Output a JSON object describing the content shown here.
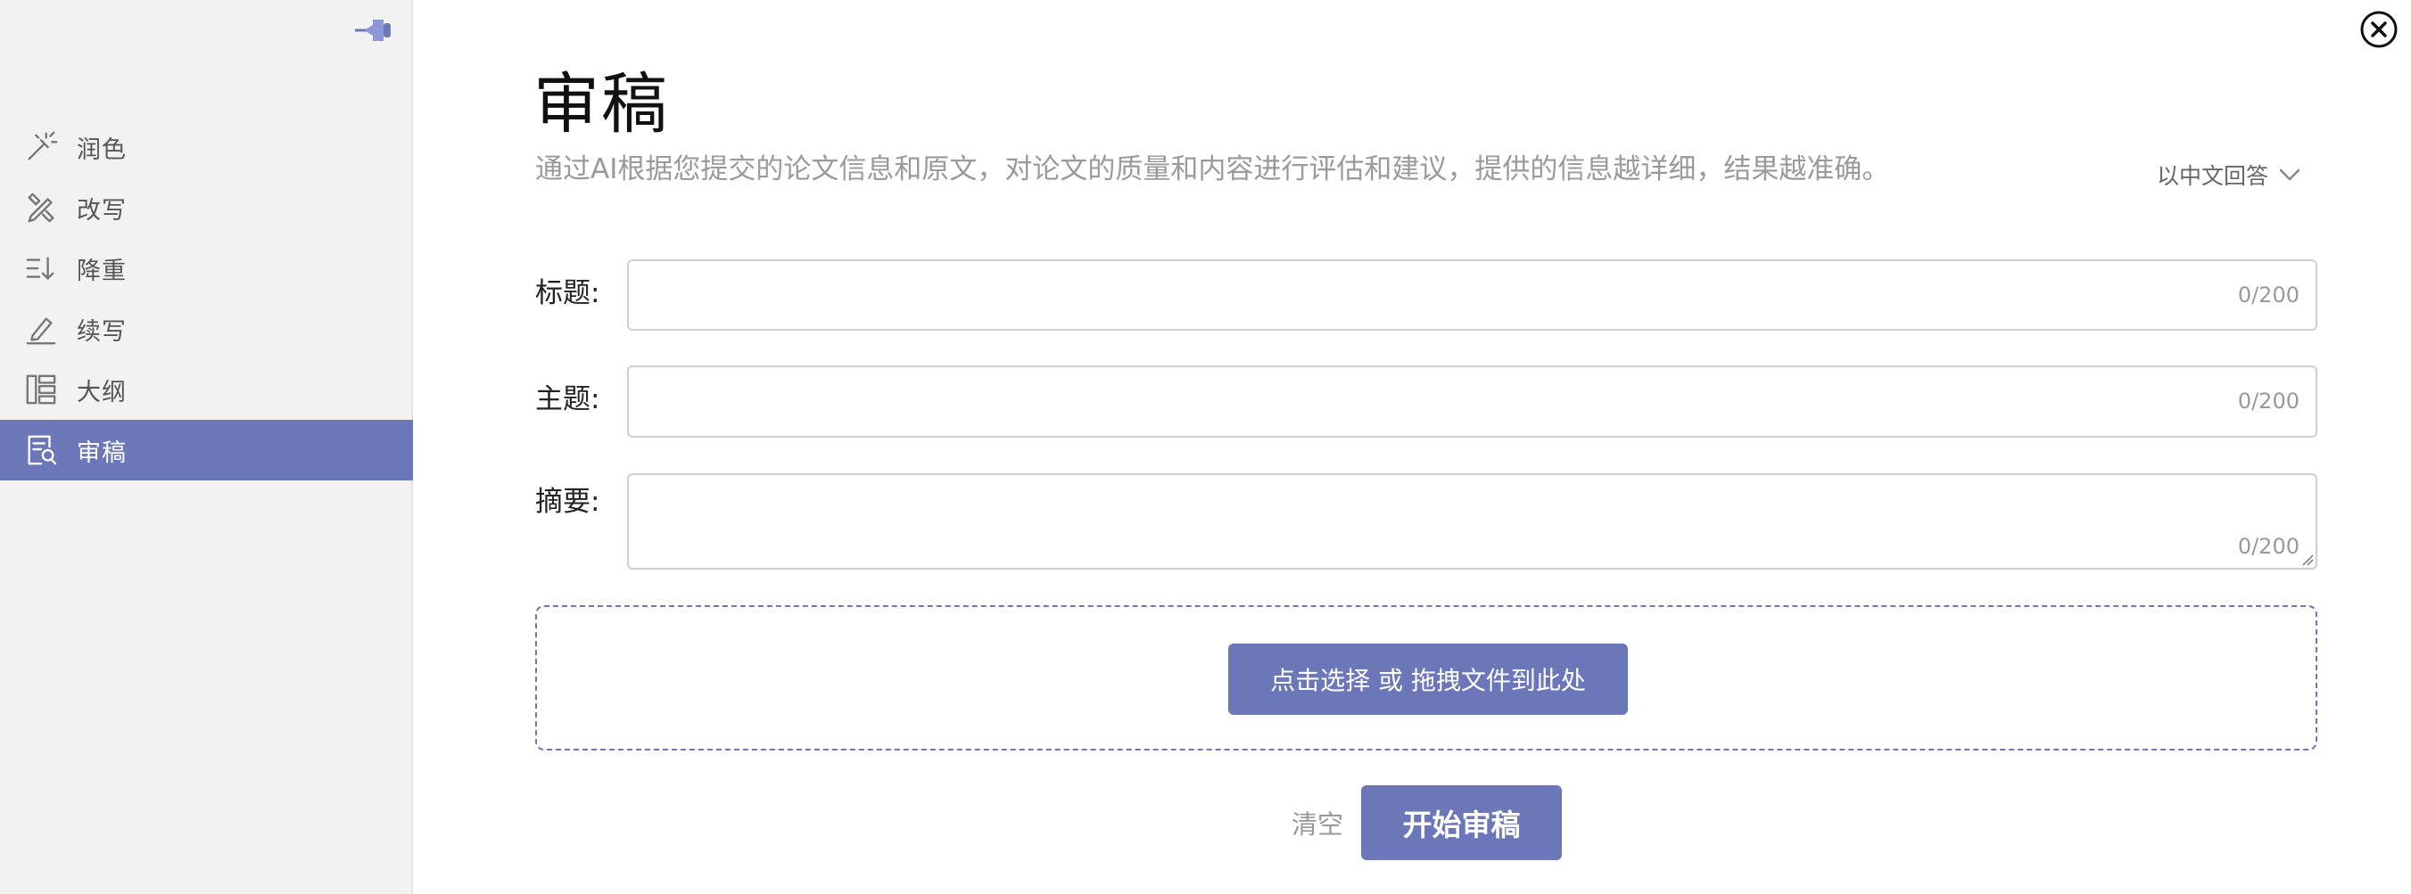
{
  "sidebar": {
    "pin_icon": "pin-icon",
    "items": [
      {
        "label": "润色",
        "icon": "magic-wand-icon",
        "active": false
      },
      {
        "label": "改写",
        "icon": "rewrite-icon",
        "active": false
      },
      {
        "label": "降重",
        "icon": "sort-down-icon",
        "active": false
      },
      {
        "label": "续写",
        "icon": "pen-icon",
        "active": false
      },
      {
        "label": "大纲",
        "icon": "outline-icon",
        "active": false
      },
      {
        "label": "审稿",
        "icon": "review-icon",
        "active": true
      }
    ]
  },
  "main": {
    "title": "审稿",
    "subtitle": "通过AI根据您提交的论文信息和原文，对论文的质量和内容进行评估和建议，提供的信息越详细，结果越准确。",
    "language_select": "以中文回答",
    "fields": {
      "title": {
        "label": "标题:",
        "value": "",
        "placeholder": "",
        "counter": "0/200"
      },
      "topic": {
        "label": "主题:",
        "value": "",
        "placeholder": "",
        "counter": "0/200"
      },
      "abstract": {
        "label": "摘要:",
        "value": "",
        "placeholder": "",
        "counter": "0/200"
      }
    },
    "upload_label": "点击选择 或 拖拽文件到此处",
    "clear_label": "清空",
    "start_label": "开始审稿"
  },
  "colors": {
    "accent": "#6b77b8",
    "sidebar_bg": "#f2f2f2"
  }
}
